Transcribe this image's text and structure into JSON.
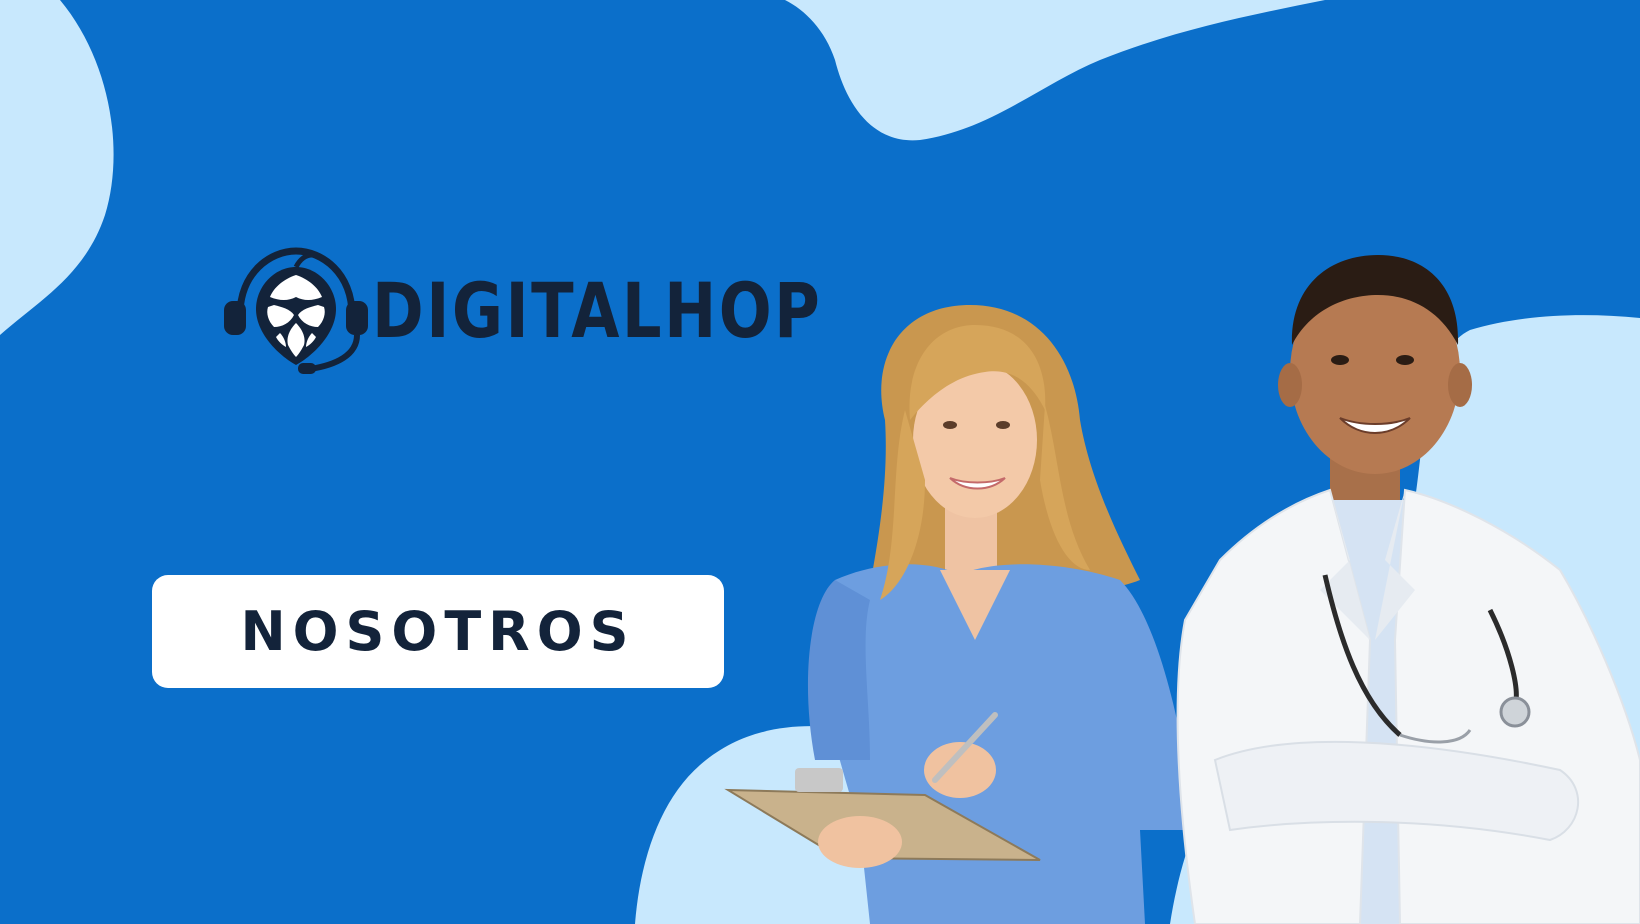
{
  "brand": {
    "name": "DIGITALHOP",
    "logo_icon": "headset-hop-icon"
  },
  "hero": {
    "title": "NOSOTROS"
  },
  "illustration": {
    "left_figure": "nurse-with-clipboard",
    "right_figure": "doctor-with-stethoscope"
  },
  "colors": {
    "background": "#0b6fca",
    "blob": "#c8e8fd",
    "text_dark": "#13233a",
    "pill": "#ffffff"
  }
}
